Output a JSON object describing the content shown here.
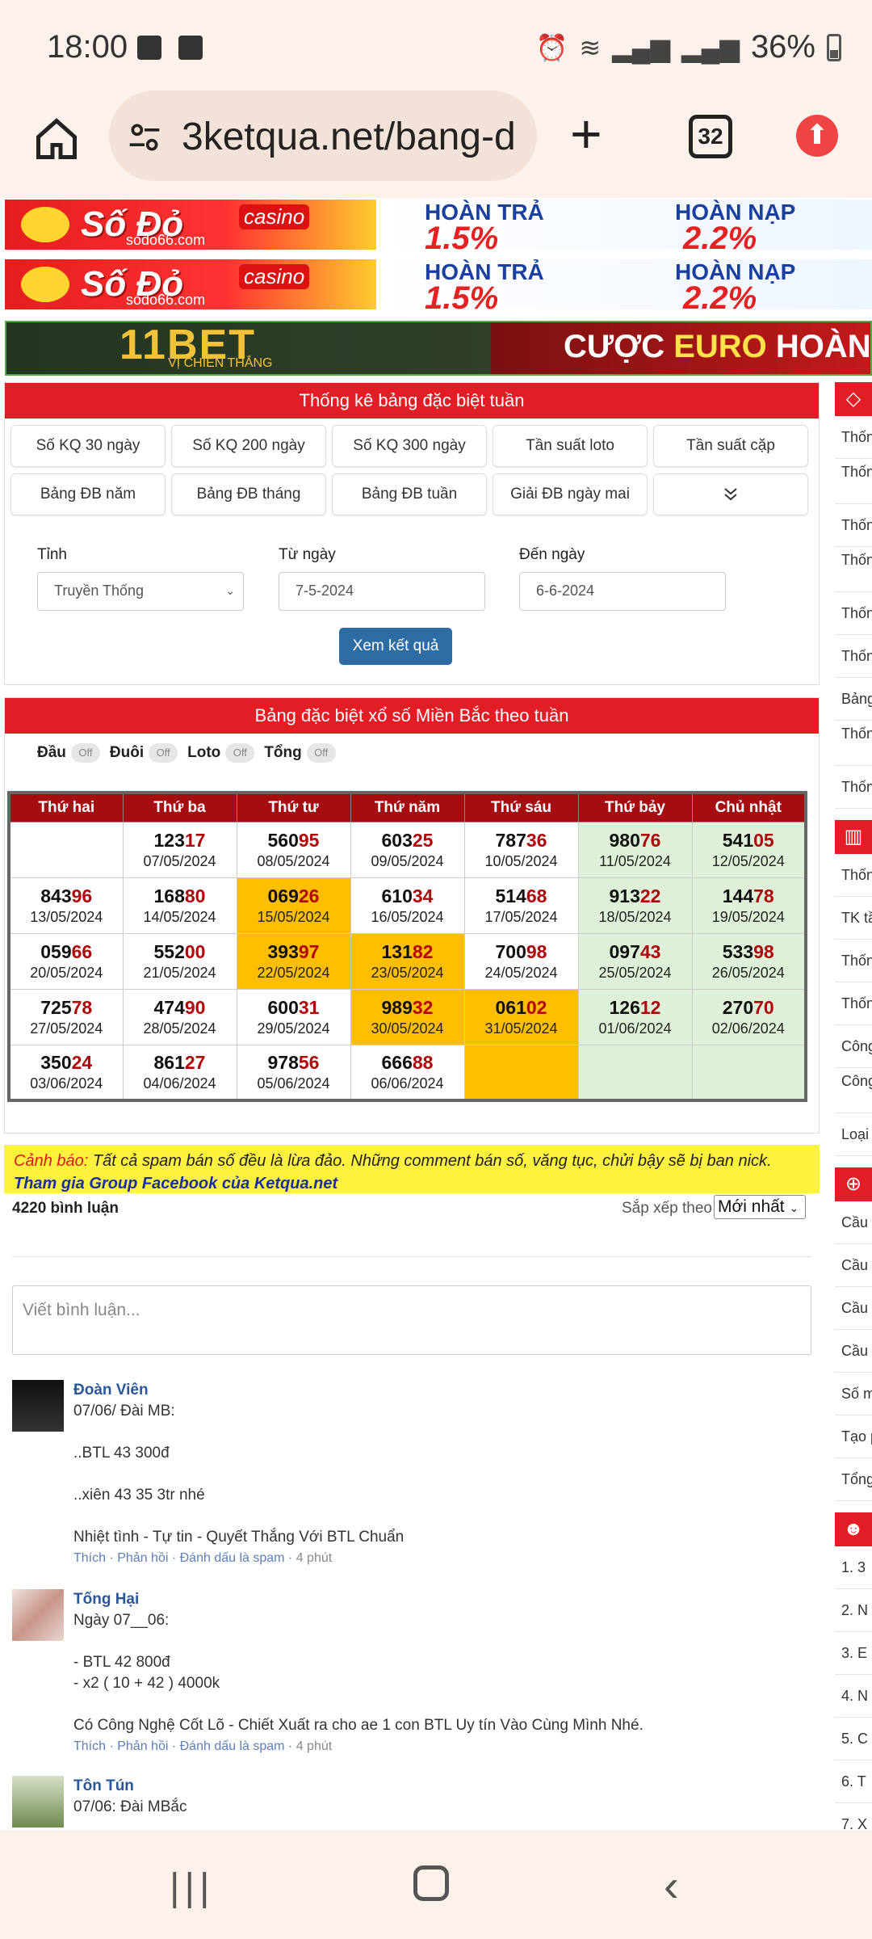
{
  "status": {
    "time": "18:00",
    "battery": "36%"
  },
  "browser": {
    "url": "3ketqua.net/bang-d",
    "tab_count": "32"
  },
  "banners": {
    "sodo_brand": "Số Đỏ",
    "sodo_casino": "casino",
    "sodo_site": "sodo66.com",
    "hoan_tra": "HOÀN TRẢ",
    "hoan_tra_value": "1.5%",
    "hoan_nap": "HOÀN NẠP",
    "hoan_nap_value": "2.2%",
    "bet_brand": "11BET",
    "bet_slogan": "VỊ CHIẾN THẮNG",
    "bet_cta_a": "CƯỢC",
    "bet_cta_b": "EURO",
    "bet_cta_c": "HOÀN"
  },
  "stats_panel": {
    "title": "Thống kê bảng đặc biệt tuần",
    "buttons": [
      "Số KQ 30 ngày",
      "Số KQ 200 ngày",
      "Số KQ 300 ngày",
      "Tần suất loto",
      "Tần suất cặp",
      "Bảng ĐB năm",
      "Bảng ĐB tháng",
      "Bảng ĐB tuần",
      "Giải ĐB ngày mai"
    ],
    "province_label": "Tỉnh",
    "province_value": "Truyền Thống",
    "from_label": "Từ ngày",
    "from_value": "7-5-2024",
    "to_label": "Đến ngày",
    "to_value": "6-6-2024",
    "submit": "Xem kết quả"
  },
  "table_panel": {
    "title": "Bảng đặc biệt xổ số Miền Bắc theo tuần",
    "toggles": {
      "dau": "Đầu",
      "duoi": "Đuôi",
      "loto": "Loto",
      "tong": "Tổng",
      "off": "Off"
    },
    "days": [
      "Thứ hai",
      "Thứ ba",
      "Thứ tư",
      "Thứ năm",
      "Thứ sáu",
      "Thứ bảy",
      "Chủ nhật"
    ],
    "rows": [
      [
        {
          "p": "",
          "s": "",
          "d": ""
        },
        {
          "p": "123",
          "s": "17",
          "d": "07/05/2024"
        },
        {
          "p": "560",
          "s": "95",
          "d": "08/05/2024"
        },
        {
          "p": "603",
          "s": "25",
          "d": "09/05/2024"
        },
        {
          "p": "787",
          "s": "36",
          "d": "10/05/2024"
        },
        {
          "p": "980",
          "s": "76",
          "d": "11/05/2024"
        },
        {
          "p": "541",
          "s": "05",
          "d": "12/05/2024"
        }
      ],
      [
        {
          "p": "843",
          "s": "96",
          "d": "13/05/2024"
        },
        {
          "p": "168",
          "s": "80",
          "d": "14/05/2024"
        },
        {
          "p": "069",
          "s": "26",
          "d": "15/05/2024"
        },
        {
          "p": "610",
          "s": "34",
          "d": "16/05/2024"
        },
        {
          "p": "514",
          "s": "68",
          "d": "17/05/2024"
        },
        {
          "p": "913",
          "s": "22",
          "d": "18/05/2024"
        },
        {
          "p": "144",
          "s": "78",
          "d": "19/05/2024"
        }
      ],
      [
        {
          "p": "059",
          "s": "66",
          "d": "20/05/2024"
        },
        {
          "p": "552",
          "s": "00",
          "d": "21/05/2024"
        },
        {
          "p": "393",
          "s": "97",
          "d": "22/05/2024"
        },
        {
          "p": "131",
          "s": "82",
          "d": "23/05/2024"
        },
        {
          "p": "700",
          "s": "98",
          "d": "24/05/2024"
        },
        {
          "p": "097",
          "s": "43",
          "d": "25/05/2024"
        },
        {
          "p": "533",
          "s": "98",
          "d": "26/05/2024"
        }
      ],
      [
        {
          "p": "725",
          "s": "78",
          "d": "27/05/2024"
        },
        {
          "p": "474",
          "s": "90",
          "d": "28/05/2024"
        },
        {
          "p": "600",
          "s": "31",
          "d": "29/05/2024"
        },
        {
          "p": "989",
          "s": "32",
          "d": "30/05/2024"
        },
        {
          "p": "061",
          "s": "02",
          "d": "31/05/2024"
        },
        {
          "p": "126",
          "s": "12",
          "d": "01/06/2024"
        },
        {
          "p": "270",
          "s": "70",
          "d": "02/06/2024"
        }
      ],
      [
        {
          "p": "350",
          "s": "24",
          "d": "03/06/2024"
        },
        {
          "p": "861",
          "s": "27",
          "d": "04/06/2024"
        },
        {
          "p": "978",
          "s": "56",
          "d": "05/06/2024"
        },
        {
          "p": "666",
          "s": "88",
          "d": "06/06/2024"
        },
        {
          "p": "",
          "s": "",
          "d": ""
        },
        {
          "p": "",
          "s": "",
          "d": ""
        },
        {
          "p": "",
          "s": "",
          "d": ""
        }
      ]
    ],
    "highlight": [
      [
        "",
        "",
        "",
        "",
        "",
        "green",
        "green"
      ],
      [
        "",
        "",
        "gold",
        "",
        "",
        "green",
        "green"
      ],
      [
        "",
        "",
        "gold",
        "gold",
        "",
        "green",
        "green"
      ],
      [
        "",
        "",
        "",
        "gold",
        "gold",
        "green",
        "green"
      ],
      [
        "",
        "",
        "",
        "",
        "gold",
        "green",
        "green"
      ]
    ]
  },
  "comments_section": {
    "warning_label": "Cảnh báo:",
    "warning_text": " Tất cả spam bán số đều là lừa đảo. Những comment bán số, văng tục, chửi bậy sẽ bị ban nick.",
    "group_link": "Tham gia Group Facebook của Ketqua.net",
    "count": "4220 bình luận",
    "sort_label": "Sắp xếp theo",
    "sort_value": "Mới nhất",
    "input_placeholder": "Viết bình luận...",
    "meta": {
      "like": "Thích",
      "reply": "Phản hồi",
      "spam": "Đánh dấu là spam"
    },
    "comments": [
      {
        "name": "Đoàn Viên",
        "l1": "07/06/ Đài MB:",
        "l2": "..BTL 43 300đ",
        "l3": "..xiên 43 35 3tr nhé",
        "l4": "Nhiệt tình - Tự tin - Quyết Thắng Với BTL Chuẩn",
        "time": "4 phút"
      },
      {
        "name": "Tống Hại",
        "l1": "Ngày 07__06:",
        "l2": "- BTL 42 800đ",
        "l3": "- x2 ( 10 + 42 ) 4000k",
        "l4": "Có Công Nghệ Cốt Lõ - Chiết Xuất ra cho ae 1 con BTL Uy tín Vào Cùng Mình Nhé.",
        "time": "4 phút"
      },
      {
        "name": "Tôn Tún",
        "l1": "07/06: Đài MBắc"
      }
    ]
  },
  "sidebar": {
    "items1": [
      "Thốn",
      "Thốn loto",
      "Thốn",
      "Thốn loto",
      "Thốn",
      "Thốn",
      "Bảng",
      "Thốn theo",
      "Thốn"
    ],
    "items2": [
      "Thốn",
      "TK tầ",
      "Thốn",
      "Thốn",
      "Công",
      "Công VIP",
      "Loại"
    ],
    "items3": [
      "Cầu",
      "Cầu",
      "Cầu",
      "Cầu",
      "Số m",
      "Tạo p",
      "Tổng"
    ],
    "items4": [
      "1. 3",
      "2. N",
      "3. E",
      "4. N",
      "5. C",
      "6. T",
      "7. X"
    ]
  }
}
